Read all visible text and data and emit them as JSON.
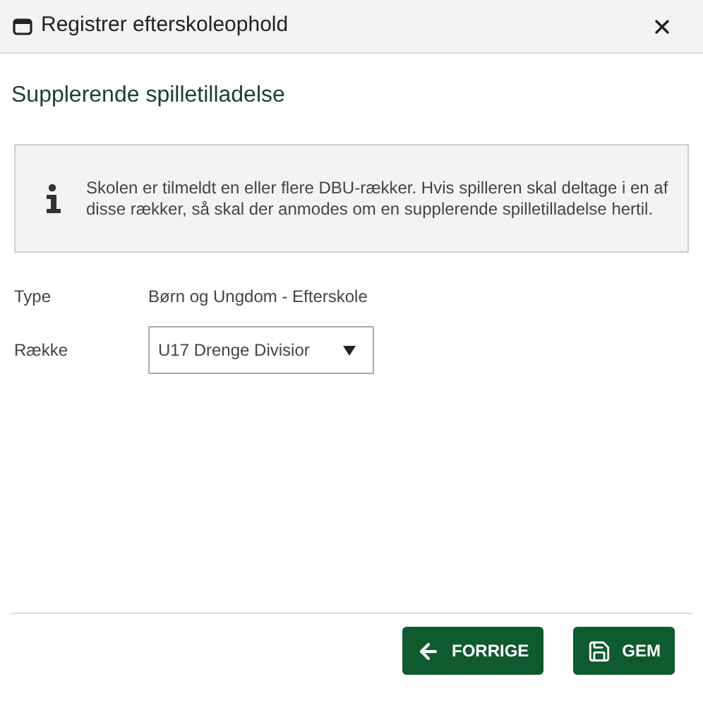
{
  "window": {
    "title": "Registrer efterskoleophold"
  },
  "heading": "Supplerende spilletilladelse",
  "info": "Skolen er tilmeldt en eller flere DBU-rækker. Hvis spilleren skal deltage i en af disse rækker, så skal der anmodes om en supplerende spilletilladelse hertil.",
  "fields": [
    {
      "kind": "text",
      "label": "Type",
      "value": "Børn og Ungdom - Efterskole"
    },
    {
      "kind": "select",
      "label": "Række",
      "value": "U17 Drenge Divisior"
    }
  ],
  "buttons": [
    {
      "kind": "back",
      "label": "FORRIGE"
    },
    {
      "kind": "save",
      "label": "GEM"
    }
  ]
}
